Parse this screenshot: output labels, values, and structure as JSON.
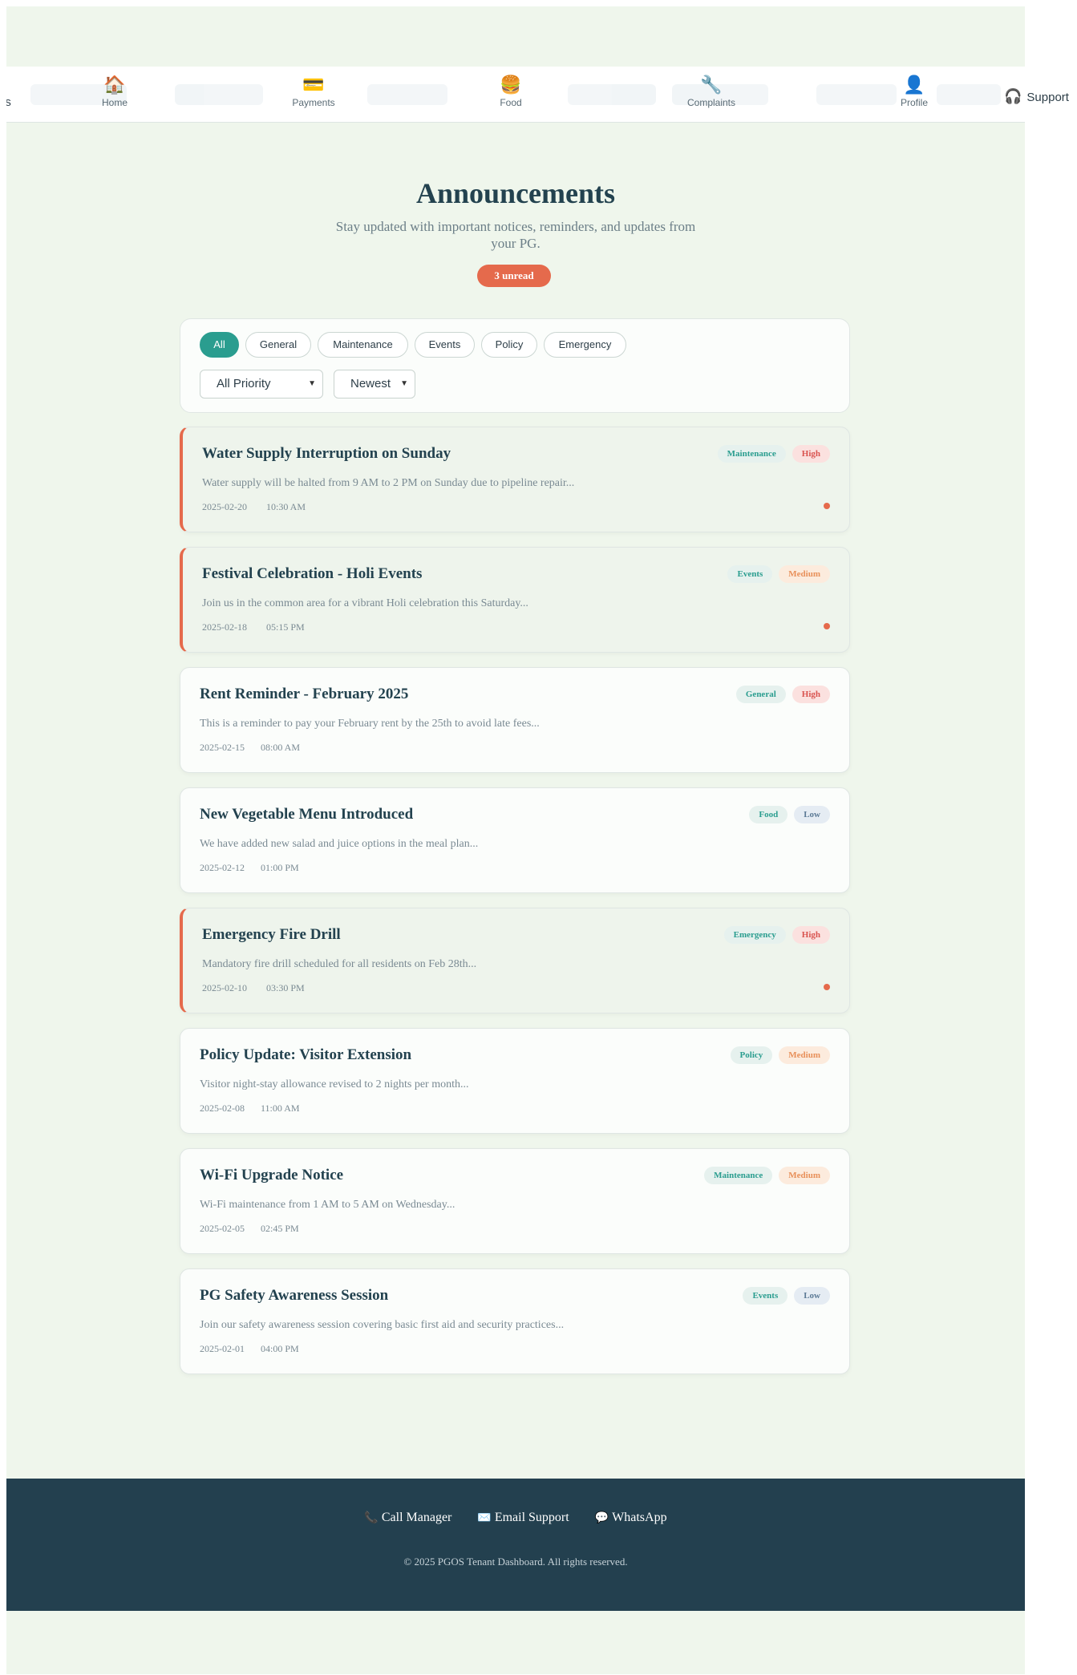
{
  "nav": {
    "left_edge_text": "as",
    "items": [
      {
        "icon": "home-icon",
        "glyph": "🏠",
        "label": "Home"
      },
      {
        "icon": "payment-card-icon",
        "glyph": "💳",
        "label": "Payments"
      },
      {
        "icon": "burger-icon",
        "glyph": "🍔",
        "label": "Food"
      },
      {
        "icon": "wrench-icon",
        "glyph": "🔧",
        "label": "Complaints"
      },
      {
        "icon": "user-icon",
        "glyph": "👤",
        "label": "Profile"
      }
    ],
    "support": {
      "icon": "headset-icon",
      "glyph": "🎧",
      "label": "Support"
    }
  },
  "header": {
    "title": "Announcements",
    "subtitle": "Stay updated with important notices, reminders, and updates from your PG.",
    "unread_badge": "3 unread"
  },
  "filters": {
    "categories": [
      "All",
      "General",
      "Maintenance",
      "Events",
      "Policy",
      "Emergency"
    ],
    "active_category": "All",
    "priority_select": "All Priority",
    "sort_select": "Newest"
  },
  "announcements": [
    {
      "title": "Water Supply Interruption on Sunday",
      "excerpt": "Water supply will be halted from 9 AM to 2 PM on Sunday due to pipeline repair...",
      "date": "2025-02-20",
      "time": "10:30 AM",
      "category": "Maintenance",
      "priority": "High",
      "unread": true
    },
    {
      "title": "Festival Celebration - Holi Events",
      "excerpt": "Join us in the common area for a vibrant Holi celebration this Saturday...",
      "date": "2025-02-18",
      "time": "05:15 PM",
      "category": "Events",
      "priority": "Medium",
      "unread": true
    },
    {
      "title": "Rent Reminder - February 2025",
      "excerpt": "This is a reminder to pay your February rent by the 25th to avoid late fees...",
      "date": "2025-02-15",
      "time": "08:00 AM",
      "category": "General",
      "priority": "High",
      "unread": false
    },
    {
      "title": "New Vegetable Menu Introduced",
      "excerpt": "We have added new salad and juice options in the meal plan...",
      "date": "2025-02-12",
      "time": "01:00 PM",
      "category": "Food",
      "priority": "Low",
      "unread": false
    },
    {
      "title": "Emergency Fire Drill",
      "excerpt": "Mandatory fire drill scheduled for all residents on Feb 28th...",
      "date": "2025-02-10",
      "time": "03:30 PM",
      "category": "Emergency",
      "priority": "High",
      "unread": true
    },
    {
      "title": "Policy Update: Visitor Extension",
      "excerpt": "Visitor night-stay allowance revised to 2 nights per month...",
      "date": "2025-02-08",
      "time": "11:00 AM",
      "category": "Policy",
      "priority": "Medium",
      "unread": false
    },
    {
      "title": "Wi-Fi Upgrade Notice",
      "excerpt": "Wi-Fi maintenance from 1 AM to 5 AM on Wednesday...",
      "date": "2025-02-05",
      "time": "02:45 PM",
      "category": "Maintenance",
      "priority": "Medium",
      "unread": false
    },
    {
      "title": "PG Safety Awareness Session",
      "excerpt": "Join our safety awareness session covering basic first aid and security practices...",
      "date": "2025-02-01",
      "time": "04:00 PM",
      "category": "Events",
      "priority": "Low",
      "unread": false
    }
  ],
  "footer": {
    "links": [
      {
        "icon": "phone-icon",
        "glyph": "📞",
        "label": "Call Manager"
      },
      {
        "icon": "envelope-icon",
        "glyph": "✉️",
        "label": "Email Support"
      },
      {
        "icon": "chat-icon",
        "glyph": "💬",
        "label": "WhatsApp"
      }
    ],
    "copyright": "© 2025 PGOS Tenant Dashboard. All rights reserved."
  },
  "colors": {
    "accent_teal": "#2a9d8f",
    "accent_coral": "#e56a4c",
    "footer_bg": "#23404f",
    "page_bg": "#eff6ec"
  }
}
